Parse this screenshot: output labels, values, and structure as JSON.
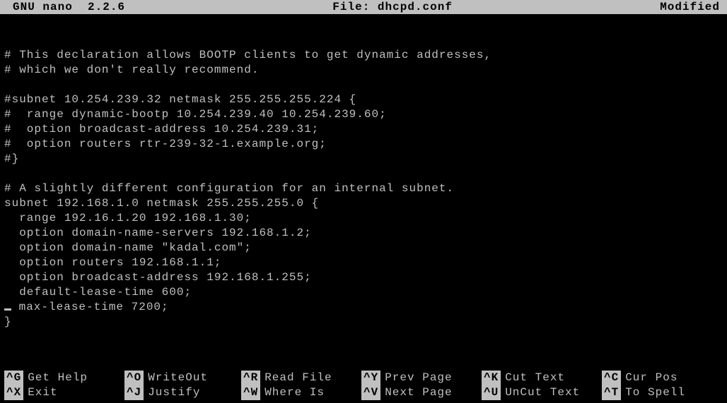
{
  "titlebar": {
    "app": "GNU nano",
    "version": "2.2.6",
    "file_label": "File:",
    "filename": "dhcpd.conf",
    "status": "Modified"
  },
  "editor": {
    "lines": [
      "",
      "",
      "# This declaration allows BOOTP clients to get dynamic addresses,",
      "# which we don't really recommend.",
      "",
      "#subnet 10.254.239.32 netmask 255.255.255.224 {",
      "#  range dynamic-bootp 10.254.239.40 10.254.239.60;",
      "#  option broadcast-address 10.254.239.31;",
      "#  option routers rtr-239-32-1.example.org;",
      "#}",
      "",
      "# A slightly different configuration for an internal subnet.",
      "subnet 192.168.1.0 netmask 255.255.255.0 {",
      "  range 192.16.1.20 192.168.1.30;",
      "  option domain-name-servers 192.168.1.2;",
      "  option domain-name \"kadal.com\";",
      "  option routers 192.168.1.1;",
      "  option broadcast-address 192.168.1.255;",
      "  default-lease-time 600;"
    ],
    "cursor_line": " max-lease-time 7200;",
    "after_cursor": "}"
  },
  "shortcuts": {
    "row1": [
      {
        "key": "^G",
        "label": "Get Help"
      },
      {
        "key": "^O",
        "label": "WriteOut"
      },
      {
        "key": "^R",
        "label": "Read File"
      },
      {
        "key": "^Y",
        "label": "Prev Page"
      },
      {
        "key": "^K",
        "label": "Cut Text"
      },
      {
        "key": "^C",
        "label": "Cur Pos"
      }
    ],
    "row2": [
      {
        "key": "^X",
        "label": "Exit"
      },
      {
        "key": "^J",
        "label": "Justify"
      },
      {
        "key": "^W",
        "label": "Where Is"
      },
      {
        "key": "^V",
        "label": "Next Page"
      },
      {
        "key": "^U",
        "label": "UnCut Text"
      },
      {
        "key": "^T",
        "label": "To Spell"
      }
    ]
  }
}
